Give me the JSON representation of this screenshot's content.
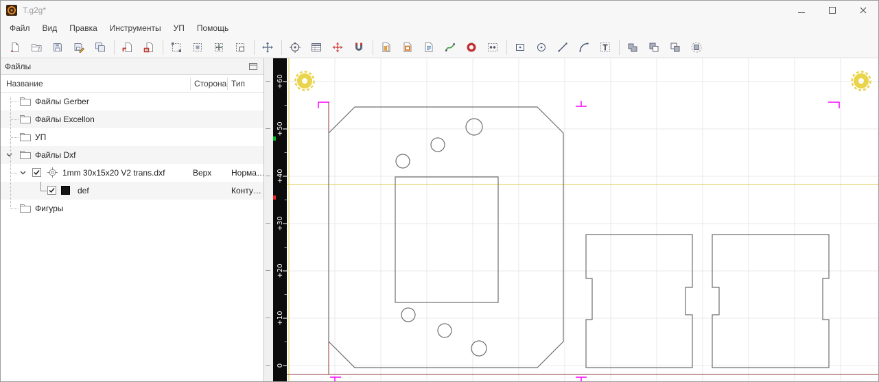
{
  "window": {
    "title": "T.g2g*",
    "controls": [
      "minimize",
      "maximize",
      "close"
    ]
  },
  "menu": {
    "items": [
      {
        "label": "Файл"
      },
      {
        "label": "Вид"
      },
      {
        "label": "Правка"
      },
      {
        "label": "Инструменты"
      },
      {
        "label": "УП"
      },
      {
        "label": "Помощь"
      }
    ]
  },
  "toolbar": {
    "buttons": [
      "new-document",
      "open-file",
      "save-file",
      "save-file-as",
      "save-all",
      "import-file",
      "close-file",
      "select-rect",
      "zoom-window",
      "zoom-extents",
      "zoom-selection",
      "pan-view",
      "set-origin",
      "job-table",
      "position-tool",
      "snap-magnet",
      "mirror-layer",
      "copper-layer",
      "drill-layer",
      "spline-tool",
      "donut-pad",
      "pad-array",
      "draw-rectangle",
      "draw-circle",
      "draw-line",
      "draw-arc",
      "draw-text",
      "polygon-union",
      "polygon-subtract",
      "polygon-xor",
      "polygon-outline"
    ]
  },
  "files_panel": {
    "title": "Файлы",
    "columns": {
      "name": "Название",
      "side": "Сторона",
      "type": "Тип"
    },
    "rows": [
      {
        "label": "Файлы Gerber",
        "side": "",
        "type": ""
      },
      {
        "label": "Файлы Excellon",
        "side": "",
        "type": ""
      },
      {
        "label": "УП",
        "side": "",
        "type": ""
      },
      {
        "label": "Файлы Dxf",
        "side": "",
        "type": "",
        "expanded": true
      },
      {
        "label": "1mm 30x15x20 V2 trans.dxf",
        "side": "Верх",
        "type": "Норма…",
        "checked": true,
        "expanded": true
      },
      {
        "label": "def",
        "side": "",
        "type": "Конту…",
        "checked": true
      },
      {
        "label": "Фигуры",
        "side": "",
        "type": ""
      }
    ]
  },
  "canvas": {
    "ruler_labels": [
      "+60",
      "+50",
      "+40",
      "+30",
      "+20",
      "+10",
      "0"
    ],
    "colors": {
      "grid": "#e9e9e9",
      "axis_yellow": "#d9cb4a",
      "board_maroon": "#8b3a3a",
      "marker_magenta": "#ff00ff",
      "target_yellow": "#e9d44c",
      "outline_gray": "#6e6e6e"
    }
  }
}
